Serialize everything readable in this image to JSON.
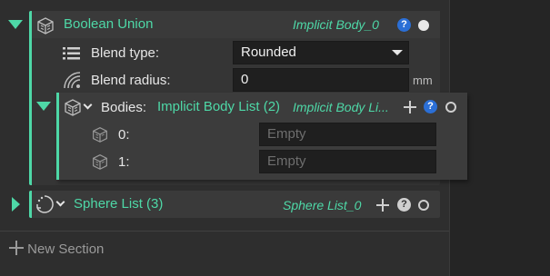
{
  "boolean_union": {
    "title": "Boolean Union",
    "instance_name": "Implicit Body_0",
    "help_label": "?",
    "blend_type_label": "Blend type:",
    "blend_type_value": "Rounded",
    "blend_radius_label": "Blend radius:",
    "blend_radius_value": "0",
    "blend_radius_unit": "mm"
  },
  "bodies": {
    "label": "Bodies:",
    "list_title": "Implicit Body List (2)",
    "list_name": "Implicit Body Li...",
    "help_label": "?",
    "items": [
      {
        "index": "0:",
        "value": "Empty"
      },
      {
        "index": "1:",
        "value": "Empty"
      }
    ]
  },
  "sphere_list": {
    "title": "Sphere List (3)",
    "instance_name": "Sphere List_0",
    "help_label": "?"
  },
  "new_section_label": "New Section",
  "colors": {
    "accent": "#4ed8a7",
    "background": "#2e2e2e",
    "help_blue": "#2b6fd6"
  }
}
